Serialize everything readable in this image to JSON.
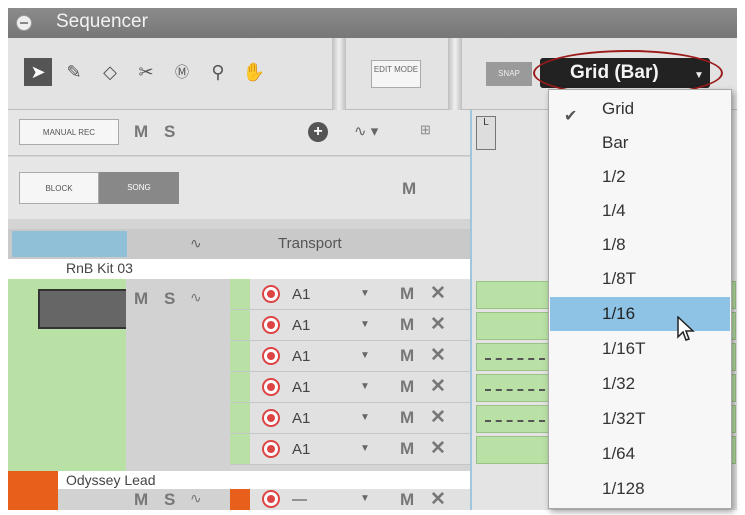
{
  "title": "Sequencer",
  "toolbar": {
    "edit_mode_label": "EDIT MODE",
    "snap_label": "SNAP",
    "grid_value": "Grid (Bar)",
    "tools": [
      "arrow-tool-icon",
      "pencil-tool-icon",
      "eraser-tool-icon",
      "razor-tool-icon",
      "mute-tool-icon",
      "magnify-tool-icon",
      "hand-tool-icon"
    ]
  },
  "panel": {
    "manual_rec_label": "MANUAL REC",
    "m_label": "M",
    "s_label": "S",
    "block_label": "BLOCK",
    "song_label": "SONG",
    "transport_label": "Transport"
  },
  "tracks": [
    {
      "name": "RnB Kit 03",
      "lanes": [
        "A1",
        "A1",
        "A1",
        "A1",
        "A1",
        "A1"
      ]
    },
    {
      "name": "Odyssey Lead",
      "lanes": [
        "—"
      ]
    }
  ],
  "lane_m": "M",
  "lane_x": "✕",
  "dropdown": {
    "items": [
      "Grid",
      "Bar",
      "1/2",
      "1/4",
      "1/8",
      "1/8T",
      "1/16",
      "1/16T",
      "1/32",
      "1/32T",
      "1/64",
      "1/128"
    ],
    "checked": "Grid",
    "highlighted": "1/16"
  },
  "colors": {
    "accent": "#8fc3e6",
    "highlight_oval": "#9b1b1b",
    "track_green": "#b9e0a5",
    "track_orange": "#e85f1c"
  }
}
